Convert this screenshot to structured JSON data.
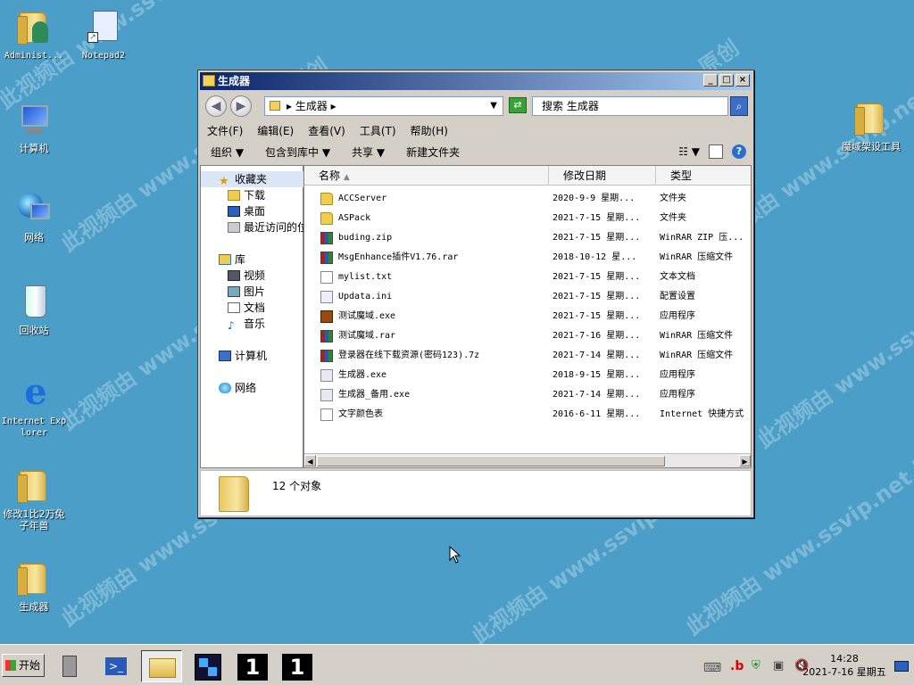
{
  "watermark": "此视频由 www.ssvip.net 原创",
  "desktop_icons": [
    {
      "label": "Administ..."
    },
    {
      "label": "Notepad2"
    },
    {
      "label": "计算机"
    },
    {
      "label": "网络"
    },
    {
      "label": "回收站"
    },
    {
      "label": "Internet Explorer"
    },
    {
      "label": "修改1比2万兔子年兽"
    },
    {
      "label": "生成器"
    },
    {
      "label": "魔域架设工具"
    }
  ],
  "window": {
    "title": "生成器",
    "controls": {
      "minimize": "_",
      "maximize": "□",
      "close": "×"
    },
    "address": "▸ 生成器 ▸",
    "search_placeholder": "搜索 生成器",
    "menu": [
      "文件(F)",
      "编辑(E)",
      "查看(V)",
      "工具(T)",
      "帮助(H)"
    ],
    "toolbar": [
      "组织 ▼",
      "包含到库中 ▼",
      "共享 ▼",
      "新建文件夹"
    ],
    "nav": {
      "favorites": "收藏夹",
      "downloads": "下载",
      "desktop": "桌面",
      "recent": "最近访问的位置",
      "libraries": "库",
      "videos": "视频",
      "pictures": "图片",
      "documents": "文档",
      "music": "音乐",
      "computer": "计算机",
      "network": "网络"
    },
    "columns": {
      "name": "名称",
      "date": "修改日期",
      "type": "类型"
    },
    "files": [
      {
        "name": "ACCServer",
        "date": "2020-9-9 星期...",
        "type": "文件夹",
        "icon": "folder"
      },
      {
        "name": "ASPack",
        "date": "2021-7-15 星期...",
        "type": "文件夹",
        "icon": "folder"
      },
      {
        "name": "buding.zip",
        "date": "2021-7-15 星期...",
        "type": "WinRAR ZIP 压...",
        "icon": "zip"
      },
      {
        "name": "MsgEnhance插件V1.76.rar",
        "date": "2018-10-12 星...",
        "type": "WinRAR 压缩文件",
        "icon": "zip"
      },
      {
        "name": "mylist.txt",
        "date": "2021-7-15 星期...",
        "type": "文本文档",
        "icon": "txt"
      },
      {
        "name": "Updata.ini",
        "date": "2021-7-15 星期...",
        "type": "配置设置",
        "icon": "ini"
      },
      {
        "name": "测试魔域.exe",
        "date": "2021-7-15 星期...",
        "type": "应用程序",
        "icon": "exe"
      },
      {
        "name": "测试魔域.rar",
        "date": "2021-7-16 星期...",
        "type": "WinRAR 压缩文件",
        "icon": "zip"
      },
      {
        "name": "登录器在线下载资源(密码123).7z",
        "date": "2021-7-14 星期...",
        "type": "WinRAR 压缩文件",
        "icon": "zip"
      },
      {
        "name": "生成器.exe",
        "date": "2018-9-15 星期...",
        "type": "应用程序",
        "icon": "exe2"
      },
      {
        "name": "生成器_备用.exe",
        "date": "2021-7-14 星期...",
        "type": "应用程序",
        "icon": "exe2"
      },
      {
        "name": "文字颜色表",
        "date": "2016-6-11 星期...",
        "type": "Internet 快捷方式",
        "icon": "lnk"
      }
    ],
    "status_count": "12 个对象"
  },
  "taskbar": {
    "start": "开始",
    "clock_time": "14:28",
    "clock_date": "2021-7-16 星期五"
  },
  "colors": {
    "desktop": "#4a9ec8",
    "titlebar": "#0a246a",
    "taskbar": "#d4d0c8"
  }
}
